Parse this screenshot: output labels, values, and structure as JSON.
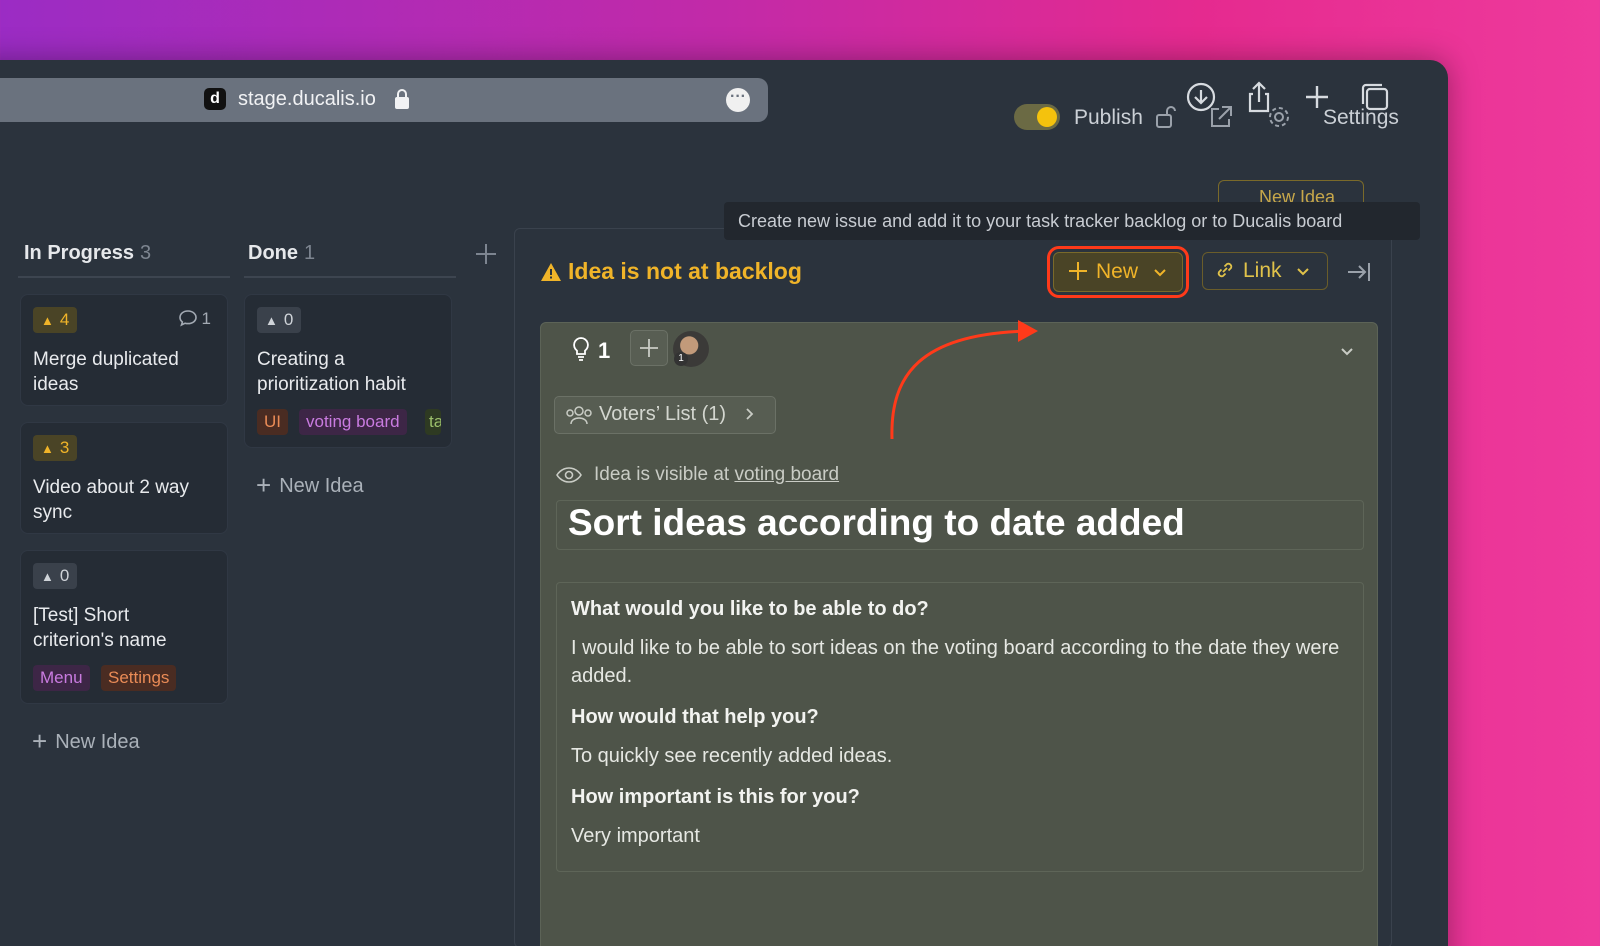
{
  "browser": {
    "favicon_letter": "d",
    "url": "stage.ducalis.io"
  },
  "toolbar": {
    "publish_label": "Publish",
    "settings_label": "Settings"
  },
  "tooltip": {
    "text": "Create new issue and add it to your task tracker backlog or to Ducalis board",
    "behind_button_label": "New Idea"
  },
  "columns": [
    {
      "name": "In Progress",
      "count": "3",
      "cards": [
        {
          "votes": "4",
          "comments": "1",
          "title": "Merge duplicated ideas"
        },
        {
          "votes": "3",
          "title": "Video about 2 way sync"
        },
        {
          "votes": "0",
          "title": "[Test] Short criterion's name",
          "tags": [
            "Menu",
            "Settings"
          ]
        }
      ],
      "new_idea_label": "New Idea"
    },
    {
      "name": "Done",
      "count": "1",
      "cards": [
        {
          "votes": "0",
          "title": "Creating a prioritization habit",
          "tags": [
            "UI",
            "voting board",
            "ta"
          ]
        }
      ],
      "new_idea_label": "New Idea"
    }
  ],
  "panel": {
    "warning": "Idea is not at backlog",
    "new_button": "New",
    "link_button": "Link",
    "idea_count": "1",
    "avatar_badge": "1",
    "voters_list": "Voters’ List (1)",
    "visible_prefix": "Idea is visible at",
    "visible_link": "voting board",
    "idea_title": "Sort ideas according to date added",
    "qa": [
      {
        "q": "What would you like to be able to do?",
        "a": "I would like to be able to sort ideas on the voting board according to the date they were added."
      },
      {
        "q": "How would that help you?",
        "a": "To quickly see recently added ideas."
      },
      {
        "q": "How important is this for you?",
        "a": "Very important"
      }
    ]
  },
  "colors": {
    "accent": "#f0b429",
    "highlight": "#ff3a1a",
    "background_start": "#9b2cc4",
    "background_end": "#ee3a9c"
  }
}
